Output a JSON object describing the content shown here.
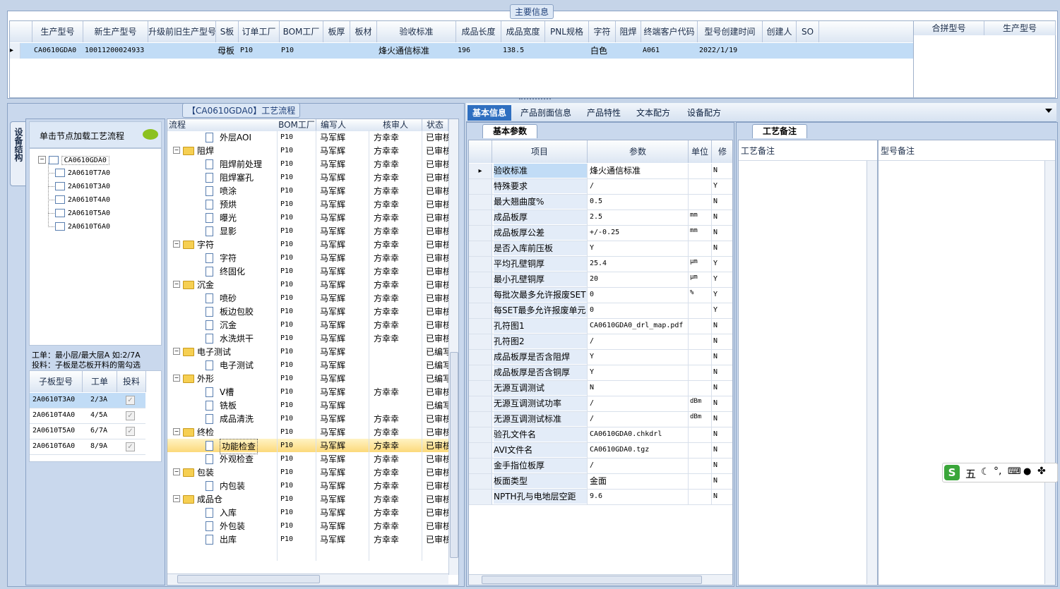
{
  "main_info": {
    "title": "主要信息",
    "columns": [
      "生产型号",
      "新生产型号",
      "升级前旧生产型号",
      "S板",
      "订单工厂",
      "BOM工厂",
      "板厚",
      "板材",
      "验收标准",
      "成品长度",
      "成品宽度",
      "PNL规格",
      "字符",
      "阻焊",
      "终端客户代码",
      "型号创建时间",
      "创建人",
      "SO"
    ],
    "row": [
      "CA0610GDA0",
      "10011200024933",
      "",
      "母板",
      "P10",
      "P10",
      "",
      "",
      "烽火通信标准",
      "196",
      "138.5",
      "",
      "白色",
      "",
      "A061",
      "2022/1/19",
      "",
      ""
    ],
    "side_columns": [
      "合拼型号",
      "生产型号"
    ]
  },
  "process": {
    "title": "【CA0610GDA0】工艺流程",
    "side_tab": "设备结构",
    "hint": "单击节点加载工艺流程",
    "tree_root": "CA0610GDA0",
    "tree_children": [
      "2A0610T7A0",
      "2A0610T3A0",
      "2A0610T4A0",
      "2A0610T5A0",
      "2A0610T6A0"
    ],
    "note1": "工单：最小层/最大层A 如:2/7A",
    "note2": "投料：子板是芯板开料的需勾选",
    "sub_columns": [
      "子板型号",
      "工单",
      "投料"
    ],
    "sub_rows": [
      {
        "model": "2A0610T3A0",
        "order": "2/3A"
      },
      {
        "model": "2A0610T4A0",
        "order": "4/5A"
      },
      {
        "model": "2A0610T5A0",
        "order": "6/7A"
      },
      {
        "model": "2A0610T6A0",
        "order": "8/9A"
      }
    ],
    "flow_columns": [
      "流程",
      "BOM工厂",
      "编写人",
      "核审人",
      "状态"
    ],
    "flow_rows": [
      {
        "name": "外层AOI",
        "folder": false,
        "bom": "P10",
        "writer": "马军辉",
        "reviewer": "方幸幸",
        "status": "已审核"
      },
      {
        "name": "阻焊",
        "folder": true,
        "bom": "P10",
        "writer": "马军辉",
        "reviewer": "方幸幸",
        "status": "已审核"
      },
      {
        "name": "阻焊前处理",
        "folder": false,
        "bom": "P10",
        "writer": "马军辉",
        "reviewer": "方幸幸",
        "status": "已审核"
      },
      {
        "name": "阻焊塞孔",
        "folder": false,
        "bom": "P10",
        "writer": "马军辉",
        "reviewer": "方幸幸",
        "status": "已审核"
      },
      {
        "name": "喷涂",
        "folder": false,
        "bom": "P10",
        "writer": "马军辉",
        "reviewer": "方幸幸",
        "status": "已审核"
      },
      {
        "name": "预烘",
        "folder": false,
        "bom": "P10",
        "writer": "马军辉",
        "reviewer": "方幸幸",
        "status": "已审核"
      },
      {
        "name": "曝光",
        "folder": false,
        "bom": "P10",
        "writer": "马军辉",
        "reviewer": "方幸幸",
        "status": "已审核"
      },
      {
        "name": "显影",
        "folder": false,
        "bom": "P10",
        "writer": "马军辉",
        "reviewer": "方幸幸",
        "status": "已审核"
      },
      {
        "name": "字符",
        "folder": true,
        "bom": "P10",
        "writer": "马军辉",
        "reviewer": "方幸幸",
        "status": "已审核"
      },
      {
        "name": "字符",
        "folder": false,
        "bom": "P10",
        "writer": "马军辉",
        "reviewer": "方幸幸",
        "status": "已审核"
      },
      {
        "name": "终固化",
        "folder": false,
        "bom": "P10",
        "writer": "马军辉",
        "reviewer": "方幸幸",
        "status": "已审核"
      },
      {
        "name": "沉金",
        "folder": true,
        "bom": "P10",
        "writer": "马军辉",
        "reviewer": "方幸幸",
        "status": "已审核"
      },
      {
        "name": "喷砂",
        "folder": false,
        "bom": "P10",
        "writer": "马军辉",
        "reviewer": "方幸幸",
        "status": "已审核"
      },
      {
        "name": "板边包胶",
        "folder": false,
        "bom": "P10",
        "writer": "马军辉",
        "reviewer": "方幸幸",
        "status": "已审核"
      },
      {
        "name": "沉金",
        "folder": false,
        "bom": "P10",
        "writer": "马军辉",
        "reviewer": "方幸幸",
        "status": "已审核"
      },
      {
        "name": "水洗烘干",
        "folder": false,
        "bom": "P10",
        "writer": "马军辉",
        "reviewer": "方幸幸",
        "status": "已审核"
      },
      {
        "name": "电子测试",
        "folder": true,
        "bom": "P10",
        "writer": "马军辉",
        "reviewer": "",
        "status": "已编写"
      },
      {
        "name": "电子测试",
        "folder": false,
        "bom": "P10",
        "writer": "马军辉",
        "reviewer": "",
        "status": "已编写"
      },
      {
        "name": "外形",
        "folder": true,
        "bom": "P10",
        "writer": "马军辉",
        "reviewer": "",
        "status": "已编写"
      },
      {
        "name": "V槽",
        "folder": false,
        "bom": "P10",
        "writer": "马军辉",
        "reviewer": "方幸幸",
        "status": "已审核"
      },
      {
        "name": "铣板",
        "folder": false,
        "bom": "P10",
        "writer": "马军辉",
        "reviewer": "",
        "status": "已编写"
      },
      {
        "name": "成品清洗",
        "folder": false,
        "bom": "P10",
        "writer": "马军辉",
        "reviewer": "方幸幸",
        "status": "已审核"
      },
      {
        "name": "终检",
        "folder": true,
        "bom": "P10",
        "writer": "马军辉",
        "reviewer": "方幸幸",
        "status": "已审核"
      },
      {
        "name": "功能检查",
        "folder": false,
        "bom": "P10",
        "writer": "马军辉",
        "reviewer": "方幸幸",
        "status": "已审核",
        "selected": true
      },
      {
        "name": "外观检查",
        "folder": false,
        "bom": "P10",
        "writer": "马军辉",
        "reviewer": "方幸幸",
        "status": "已审核"
      },
      {
        "name": "包装",
        "folder": true,
        "bom": "P10",
        "writer": "马军辉",
        "reviewer": "方幸幸",
        "status": "已审核"
      },
      {
        "name": "内包装",
        "folder": false,
        "bom": "P10",
        "writer": "马军辉",
        "reviewer": "方幸幸",
        "status": "已审核"
      },
      {
        "name": "成品仓",
        "folder": true,
        "bom": "P10",
        "writer": "马军辉",
        "reviewer": "方幸幸",
        "status": "已审核"
      },
      {
        "name": "入库",
        "folder": false,
        "bom": "P10",
        "writer": "马军辉",
        "reviewer": "方幸幸",
        "status": "已审核"
      },
      {
        "name": "外包装",
        "folder": false,
        "bom": "P10",
        "writer": "马军辉",
        "reviewer": "方幸幸",
        "status": "已审核"
      },
      {
        "name": "出库",
        "folder": false,
        "bom": "P10",
        "writer": "马军辉",
        "reviewer": "方幸幸",
        "status": "已审核"
      }
    ]
  },
  "right_tabs": [
    "基本信息",
    "产品剖面信息",
    "产品特性",
    "文本配方",
    "设备配方"
  ],
  "basic": {
    "tab": "基本参数",
    "columns": [
      "项目",
      "参数",
      "单位",
      "修"
    ],
    "rows": [
      {
        "item": "验收标准",
        "param": "烽火通信标准",
        "unit": "",
        "flag": "N"
      },
      {
        "item": "特殊要求",
        "param": "/",
        "unit": "",
        "flag": "Y"
      },
      {
        "item": "最大翘曲度%",
        "param": "0.5",
        "unit": "",
        "flag": "N"
      },
      {
        "item": "成品板厚",
        "param": "2.5",
        "unit": "mm",
        "flag": "N"
      },
      {
        "item": "成品板厚公差",
        "param": "+/-0.25",
        "unit": "mm",
        "flag": "N"
      },
      {
        "item": "是否入库前压板",
        "param": "Y",
        "unit": "",
        "flag": "N"
      },
      {
        "item": "平均孔壁铜厚",
        "param": "25.4",
        "unit": "μm",
        "flag": "Y"
      },
      {
        "item": "最小孔壁铜厚",
        "param": "20",
        "unit": "μm",
        "flag": "Y"
      },
      {
        "item": "每批次最多允许报废SET",
        "param": "0",
        "unit": "%",
        "flag": "Y"
      },
      {
        "item": "每SET最多允许报废单元",
        "param": "0",
        "unit": "",
        "flag": "Y"
      },
      {
        "item": "孔符图1",
        "param": "CA0610GDA0_drl_map.pdf",
        "unit": "",
        "flag": "N"
      },
      {
        "item": "孔符图2",
        "param": "/",
        "unit": "",
        "flag": "N"
      },
      {
        "item": "成品板厚是否含阻焊",
        "param": "Y",
        "unit": "",
        "flag": "N"
      },
      {
        "item": "成品板厚是否含铜厚",
        "param": "Y",
        "unit": "",
        "flag": "N"
      },
      {
        "item": "无源互调测试",
        "param": "N",
        "unit": "",
        "flag": "N"
      },
      {
        "item": "无源互调测试功率",
        "param": "/",
        "unit": "dBm",
        "flag": "N"
      },
      {
        "item": "无源互调测试标准",
        "param": "/",
        "unit": "dBm",
        "flag": "N"
      },
      {
        "item": "验孔文件名",
        "param": "CA0610GDA0.chkdrl",
        "unit": "",
        "flag": "N"
      },
      {
        "item": "AVI文件名",
        "param": "CA0610GDA0.tgz",
        "unit": "",
        "flag": "N"
      },
      {
        "item": "金手指位板厚",
        "param": "/",
        "unit": "",
        "flag": "N"
      },
      {
        "item": "板面类型",
        "param": "金面",
        "unit": "",
        "flag": "N"
      },
      {
        "item": "NPTH孔与电地层空距",
        "param": "9.6",
        "unit": "",
        "flag": "N"
      }
    ]
  },
  "remarks": {
    "tab": "工艺备注",
    "columns": [
      "工艺备注",
      "型号备注"
    ]
  },
  "ime": {
    "logo": "S",
    "label": "五"
  }
}
